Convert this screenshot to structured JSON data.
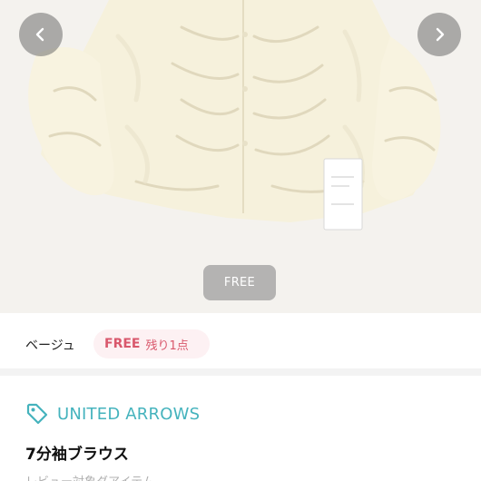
{
  "gallery": {
    "prev_icon": "chevron-left-icon",
    "next_icon": "chevron-right-icon",
    "size_chip": "FREE"
  },
  "variant": {
    "color": "ベージュ",
    "stock_size": "FREE",
    "stock_note": "残り1点"
  },
  "brand": {
    "icon": "tag-icon",
    "name": "UNITED ARROWS",
    "color": "#45b3bd"
  },
  "product": {
    "title": "7分袖ブラウス",
    "subtext": "レビュー対象ダアイテム"
  },
  "colors": {
    "accent_pink": "#d9586c",
    "pill_bg": "#fdf1f3",
    "brand_teal": "#45b3bd"
  }
}
